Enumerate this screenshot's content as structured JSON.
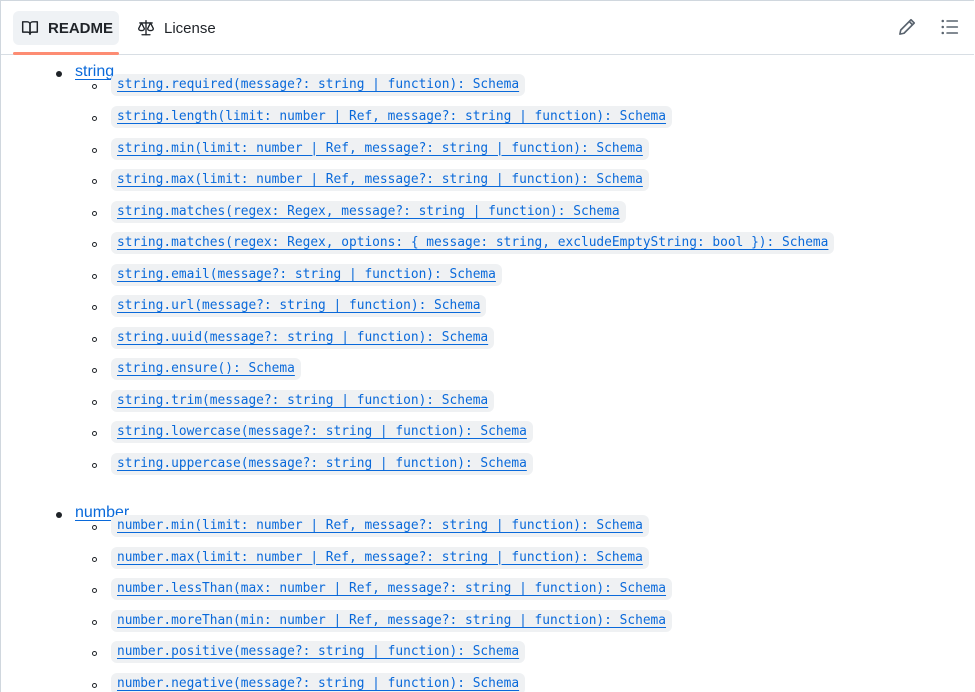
{
  "tabs": {
    "readme_label": "README",
    "license_label": "License"
  },
  "icons": {
    "readme": "book-icon",
    "license": "scale-icon",
    "edit": "pencil-icon",
    "outline": "list-icon"
  },
  "colors": {
    "link": "#0969da",
    "code_bg": "#eff1f3",
    "active_tab_underline": "#fd8c73",
    "active_tab_bg": "#eff2f5"
  },
  "sections": [
    {
      "label": "string",
      "items": [
        "string.required(message?: string | function): Schema",
        "string.length(limit: number | Ref, message?: string | function): Schema",
        "string.min(limit: number | Ref, message?: string | function): Schema",
        "string.max(limit: number | Ref, message?: string | function): Schema",
        "string.matches(regex: Regex, message?: string | function): Schema",
        "string.matches(regex: Regex, options: { message: string, excludeEmptyString: bool }): Schema",
        "string.email(message?: string | function): Schema",
        "string.url(message?: string | function): Schema",
        "string.uuid(message?: string | function): Schema",
        "string.ensure(): Schema",
        "string.trim(message?: string | function): Schema",
        "string.lowercase(message?: string | function): Schema",
        "string.uppercase(message?: string | function): Schema"
      ]
    },
    {
      "label": "number",
      "items": [
        "number.min(limit: number | Ref, message?: string | function): Schema",
        "number.max(limit: number | Ref, message?: string | function): Schema",
        "number.lessThan(max: number | Ref, message?: string | function): Schema",
        "number.moreThan(min: number | Ref, message?: string | function): Schema",
        "number.positive(message?: string | function): Schema",
        "number.negative(message?: string | function): Schema"
      ]
    }
  ]
}
